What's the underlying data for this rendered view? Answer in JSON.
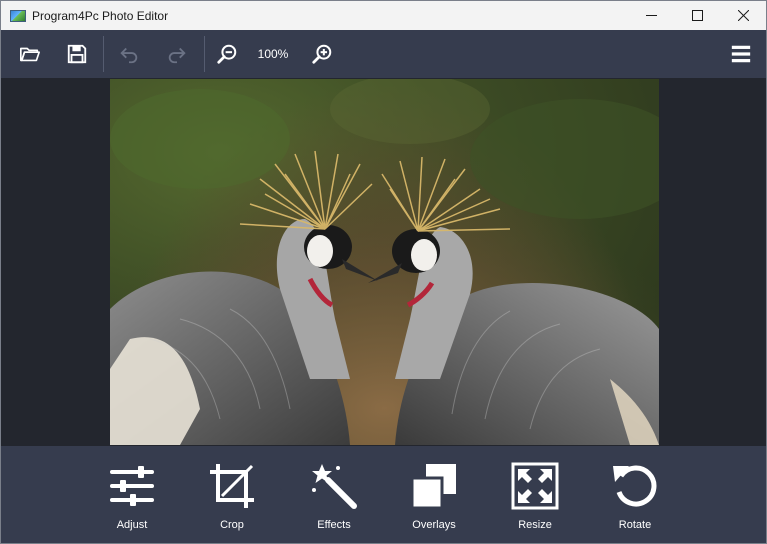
{
  "window": {
    "title": "Program4Pc Photo Editor"
  },
  "toolbar": {
    "icons": [
      "open-folder-icon",
      "save-icon",
      "undo-icon",
      "redo-icon",
      "zoom-out-icon",
      "zoom-in-icon",
      "menu-icon"
    ],
    "zoom_level": "100%"
  },
  "canvas": {
    "image_subject": "two grey crowned cranes"
  },
  "tools": [
    {
      "label": "Adjust",
      "icon": "sliders-icon"
    },
    {
      "label": "Crop",
      "icon": "crop-icon"
    },
    {
      "label": "Effects",
      "icon": "magic-wand-icon"
    },
    {
      "label": "Overlays",
      "icon": "overlays-icon"
    },
    {
      "label": "Resize",
      "icon": "resize-icon"
    },
    {
      "label": "Rotate",
      "icon": "rotate-icon"
    }
  ],
  "colors": {
    "toolbar_bg": "#363c4e",
    "canvas_bg": "#23262e",
    "titlebar_bg": "#f3f3f3",
    "icon_color": "#ffffff"
  }
}
